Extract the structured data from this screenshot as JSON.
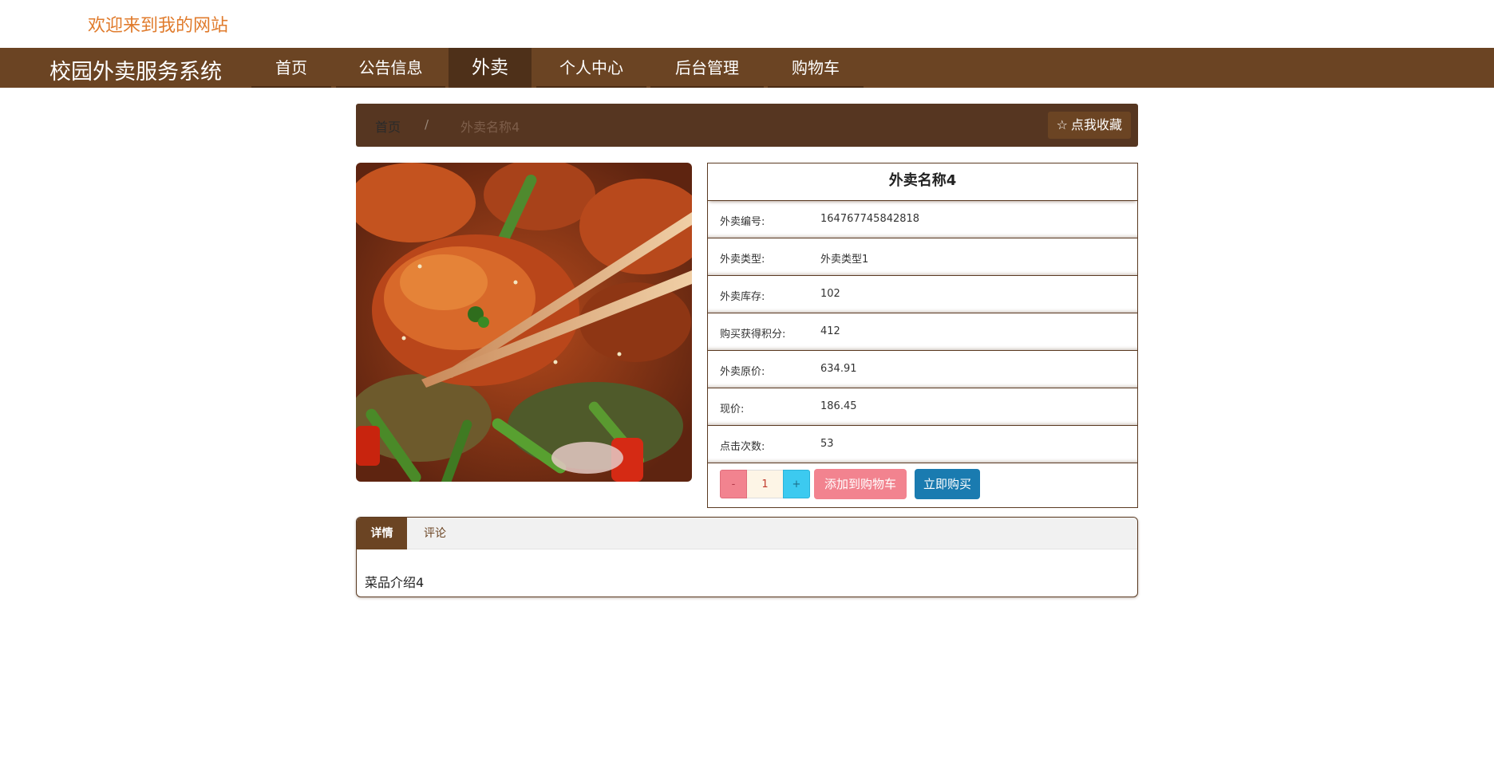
{
  "header": {
    "welcome": "欢迎来到我的网站"
  },
  "nav": {
    "brand": "校园外卖服务系统",
    "items": [
      {
        "label": "首页"
      },
      {
        "label": "公告信息"
      },
      {
        "label": "外卖",
        "active": true
      },
      {
        "label": "个人中心"
      },
      {
        "label": "后台管理"
      },
      {
        "label": "购物车"
      }
    ]
  },
  "breadcrumb": {
    "home": "首页",
    "separator": "/",
    "current": "外卖名称4",
    "favorite_label": "点我收藏",
    "favorite_icon": "star-outline-icon"
  },
  "product": {
    "image_alt": "food photo",
    "title": "外卖名称4",
    "fields": [
      {
        "key": "外卖编号:",
        "value": "164767745842818"
      },
      {
        "key": "外卖类型:",
        "value": "外卖类型1"
      },
      {
        "key": "外卖库存:",
        "value": "102"
      },
      {
        "key": "购买获得积分:",
        "value": "412"
      },
      {
        "key": "外卖原价:",
        "value": "634.91"
      },
      {
        "key": "现价:",
        "value": "186.45"
      },
      {
        "key": "点击次数:",
        "value": "53"
      }
    ],
    "quantity": {
      "minus": "-",
      "value": "1",
      "plus": "+"
    },
    "add_to_cart_label": "添加到购物车",
    "buy_now_label": "立即购买"
  },
  "tabs": {
    "items": [
      {
        "label": "详情",
        "active": true
      },
      {
        "label": "评论"
      }
    ],
    "body": "菜品介绍4"
  },
  "colors": {
    "nav_bg": "#6b4423",
    "nav_active": "#4e3019",
    "crumb_bg": "#563621",
    "welcome": "#e07b2c",
    "cart_btn": "#f2838f",
    "buy_btn": "#1a7bb0",
    "plus_btn": "#3ccaf0"
  }
}
